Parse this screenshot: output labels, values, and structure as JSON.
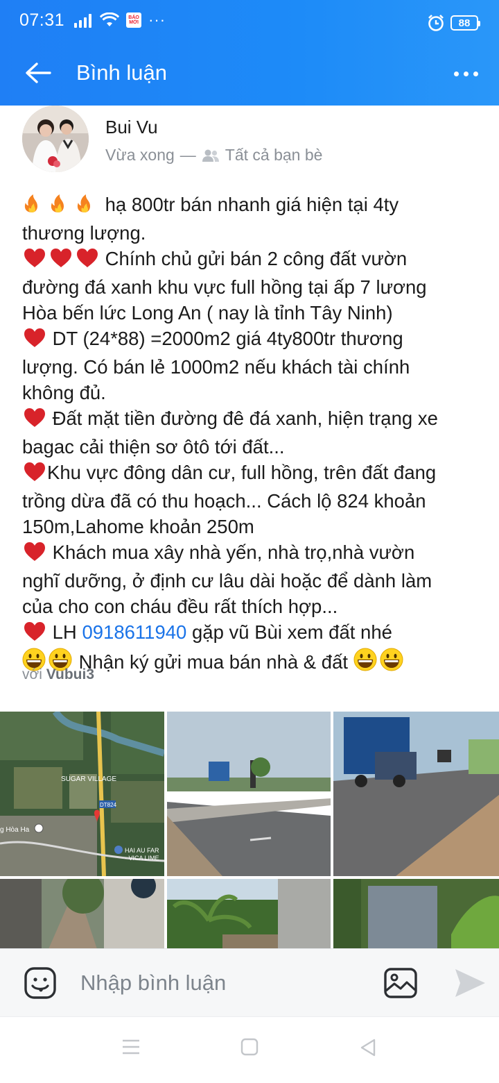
{
  "status_bar": {
    "time": "07:31",
    "app_badge": "BÁO MỚI",
    "more": "···",
    "battery": "88"
  },
  "header": {
    "title": "Bình luận"
  },
  "post": {
    "author": "Bui Vu",
    "time": "Vừa xong",
    "separator": "—",
    "audience": "Tất cả bạn bè",
    "lines": [
      " hạ 800tr bán nhanh giá hiện tại 4ty",
      "thương lượng.",
      " Chính chủ gửi bán 2 công đất vườn",
      "đường đá xanh khu vực full hồng tại ấp 7 lương",
      "Hòa bến lức Long An ( nay là tỉnh Tây Ninh)",
      " DT (24*88) =2000m2 giá 4ty800tr thương",
      "lượng. Có bán lẻ 1000m2 nếu khách tài chính",
      "không đủ.",
      " Đất mặt tiền đường đê đá xanh, hiện trạng xe",
      "bagac cải thiện sơ ôtô tới đất...",
      "Khu vực đông dân cư, full hồng, trên đất đang",
      "trồng dừa đã có thu hoạch... Cách lộ 824 khoản",
      "150m,Lahome khoản 250m",
      " Khách mua xây nhà yến, nhà trọ,nhà vườn",
      "nghĩ dưỡng, ở định cư lâu dài hoặc để dành làm",
      "của cho con cháu đều rất thích hợp...",
      " LH ",
      " gặp vũ Bùi xem đất nhé",
      " Nhận ký gửi mua bán nhà & đất "
    ],
    "phone": "0918611940",
    "with_prefix": "với",
    "tagged": "Vubui3",
    "map_labels": {
      "village": "SUGAR VILLAGE",
      "road": "DT824",
      "place_left": "g Hòa Ha",
      "place_right_1": "HAI AU FAR",
      "place_right_2": "- VICA LIME"
    },
    "photo_count": 6
  },
  "comment_bar": {
    "placeholder": "Nhập bình luận"
  },
  "colors": {
    "header": "#1d8bf8",
    "link": "#1a73e8",
    "muted": "#8a8f96"
  },
  "icons": [
    "back-arrow-icon",
    "more-dots-icon",
    "friends-icon",
    "fire-emoji",
    "heart-emoji",
    "grin-emoji",
    "emoji-smile-icon",
    "image-icon",
    "send-icon",
    "menu-icon",
    "home-square-icon",
    "back-triangle-icon"
  ]
}
